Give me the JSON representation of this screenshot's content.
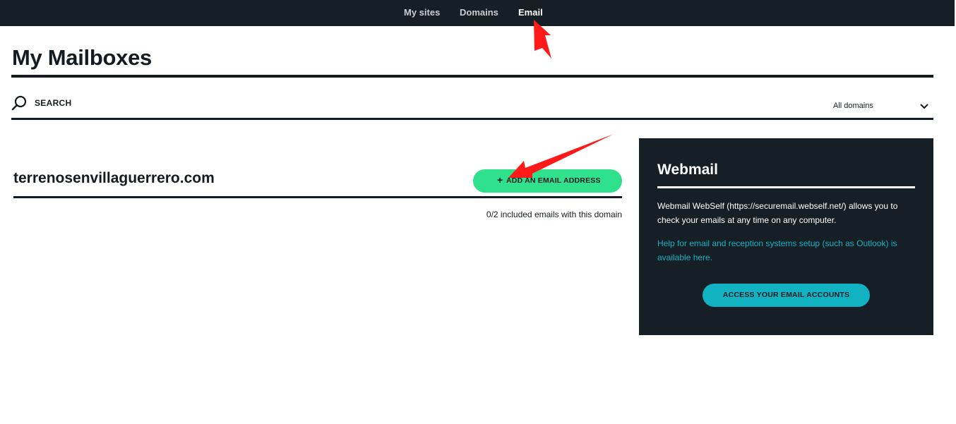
{
  "nav": {
    "items": [
      {
        "label": "My sites"
      },
      {
        "label": "Domains"
      },
      {
        "label": "Email"
      }
    ],
    "active": "Email"
  },
  "page": {
    "title": "My Mailboxes"
  },
  "search": {
    "label": "SEARCH",
    "icon": "search-icon",
    "domain_filter": {
      "selected": "All domains",
      "icon": "chevron-down-icon"
    }
  },
  "domain_section": {
    "domain": "terrenosenvillaguerrero.com",
    "add_button": {
      "icon": "plus-icon",
      "icon_glyph": "+",
      "label": "ADD AN EMAIL ADDRESS"
    },
    "quota_text": "0/2 included emails with this domain"
  },
  "webmail": {
    "title": "Webmail",
    "description": "Webmail WebSelf (https://securemail.webself.net/) allows you to check your emails at any time on any computer.",
    "help_link": "Help for email and reception systems setup (such as Outlook) is available here.",
    "button_label": "ACCESS YOUR EMAIL ACCOUNTS"
  },
  "annotations": {
    "arrow_color": "#ff1a1a"
  },
  "colors": {
    "topbar_bg": "#161e26",
    "accent_green": "#2fe08d",
    "accent_teal": "#11b2c2",
    "text_dark": "#141b22"
  }
}
